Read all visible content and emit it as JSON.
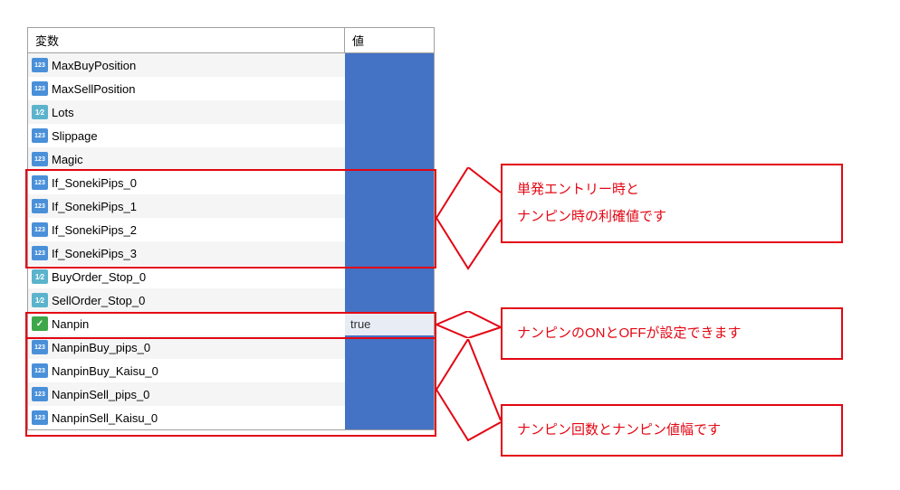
{
  "headers": {
    "name": "変数",
    "value": "値"
  },
  "rows": [
    {
      "icon": "int",
      "name": "MaxBuyPosition",
      "value": ""
    },
    {
      "icon": "int",
      "name": "MaxSellPosition",
      "value": ""
    },
    {
      "icon": "double",
      "name": "Lots",
      "value": ""
    },
    {
      "icon": "int",
      "name": "Slippage",
      "value": ""
    },
    {
      "icon": "int",
      "name": "Magic",
      "value": ""
    },
    {
      "icon": "int",
      "name": "If_SonekiPips_0",
      "value": ""
    },
    {
      "icon": "int",
      "name": "If_SonekiPips_1",
      "value": ""
    },
    {
      "icon": "int",
      "name": "If_SonekiPips_2",
      "value": ""
    },
    {
      "icon": "int",
      "name": "If_SonekiPips_3",
      "value": ""
    },
    {
      "icon": "double",
      "name": "BuyOrder_Stop_0",
      "value": ""
    },
    {
      "icon": "double",
      "name": "SellOrder_Stop_0",
      "value": ""
    },
    {
      "icon": "bool",
      "name": "Nanpin",
      "value": "true"
    },
    {
      "icon": "int",
      "name": "NanpinBuy_pips_0",
      "value": ""
    },
    {
      "icon": "int",
      "name": "NanpinBuy_Kaisu_0",
      "value": ""
    },
    {
      "icon": "int",
      "name": "NanpinSell_pips_0",
      "value": ""
    },
    {
      "icon": "int",
      "name": "NanpinSell_Kaisu_0",
      "value": ""
    }
  ],
  "annotations": {
    "a1_line1": "単発エントリー時と",
    "a1_line2": "ナンピン時の利確値です",
    "a2": "ナンピンのONとOFFが設定できます",
    "a3": "ナンピン回数とナンピン値幅です"
  }
}
